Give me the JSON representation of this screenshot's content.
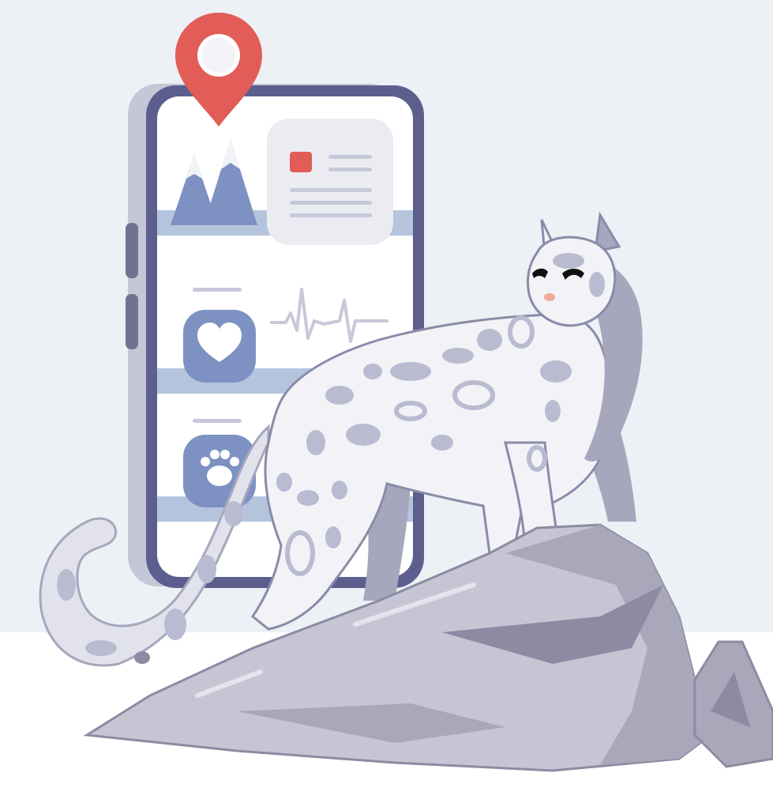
{
  "colors": {
    "background_top": "#edf0f4",
    "background_bottom": "#ffffff",
    "phone_frame": "#5c5f8e",
    "phone_shadow": "#c5c7d6",
    "phone_button": "#6f7390",
    "screen": "#ffffff",
    "row_band": "#b5c4dd",
    "icon_fill": "#7d92c2",
    "mountain": "#7d92c2",
    "snow": "#f2f3f8",
    "card": "#ebecf2",
    "card_line": "#c7c8da",
    "accent_red": "#e25d57",
    "rock_light": "#c6c5d4",
    "rock_mid": "#a9a8bb",
    "rock_dark": "#8c8ba2",
    "leopard_fur": "#f2f2f7",
    "leopard_shade": "#a6a7bd",
    "leopard_spots": "#b9bbd1",
    "outline": "#8a8ba8",
    "nose": "#f2a99a"
  },
  "icons": [
    "location-pin-icon",
    "mountain-icon",
    "heart-icon",
    "heartbeat-line-icon",
    "paw-icon"
  ]
}
